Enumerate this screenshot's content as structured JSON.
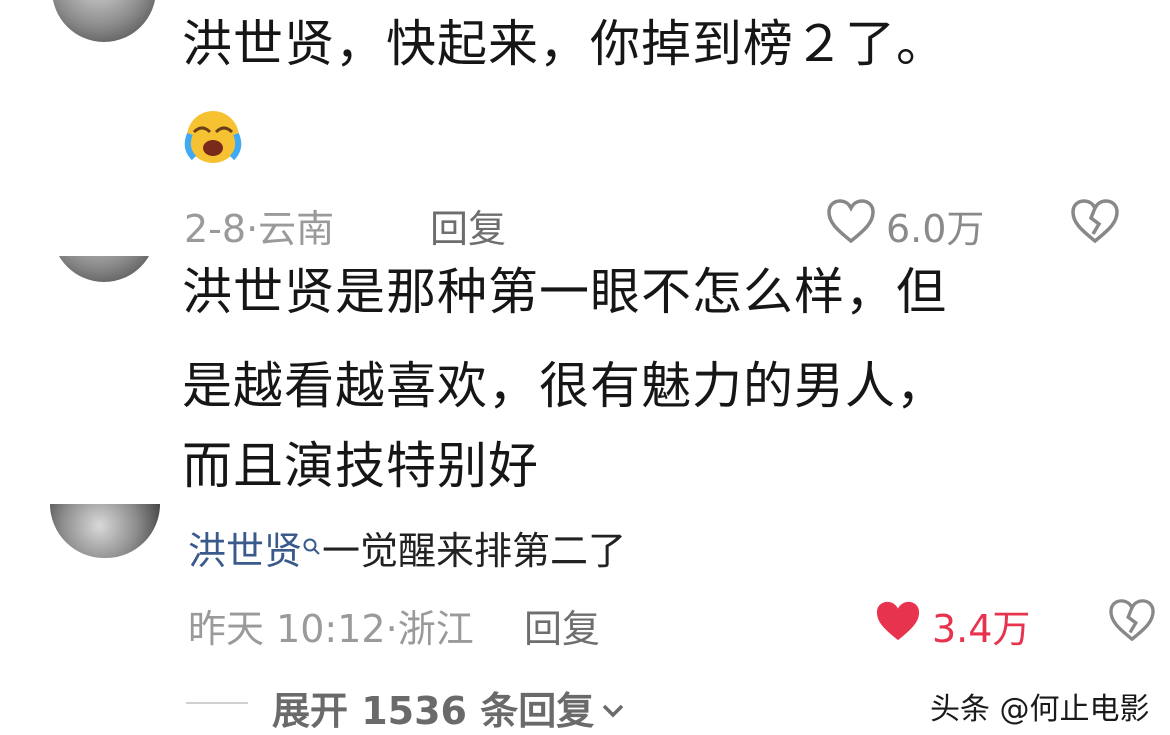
{
  "comments": [
    {
      "text": "洪世贤，快起来，你掉到榜２了。",
      "emoji": "😭",
      "date": "2-8",
      "location": "云南",
      "reply_label": "回复",
      "likes": "6.0万",
      "liked": false
    },
    {
      "lines": [
        "洪世贤是那种第一眼不怎么样，但",
        "是越看越喜欢，很有魅力的男人，",
        "而且演技特别好"
      ]
    },
    {
      "mention": "洪世贤",
      "text": "一觉醒来排第二了",
      "date": "昨天 10:12",
      "location": "浙江",
      "reply_label": "回复",
      "likes": "3.4万",
      "liked": true
    }
  ],
  "expand_replies": "展开 1536 条回复",
  "watermark": "头条 @何止电影",
  "colors": {
    "like_red": "#e8334f",
    "meta_gray": "#9a9a9a",
    "mention_blue": "#3a5a8c"
  },
  "icons": [
    "heart-outline-icon",
    "broken-heart-icon",
    "heart-filled-icon",
    "search-mini-icon",
    "chevron-down-icon",
    "crying-emoji-icon"
  ]
}
